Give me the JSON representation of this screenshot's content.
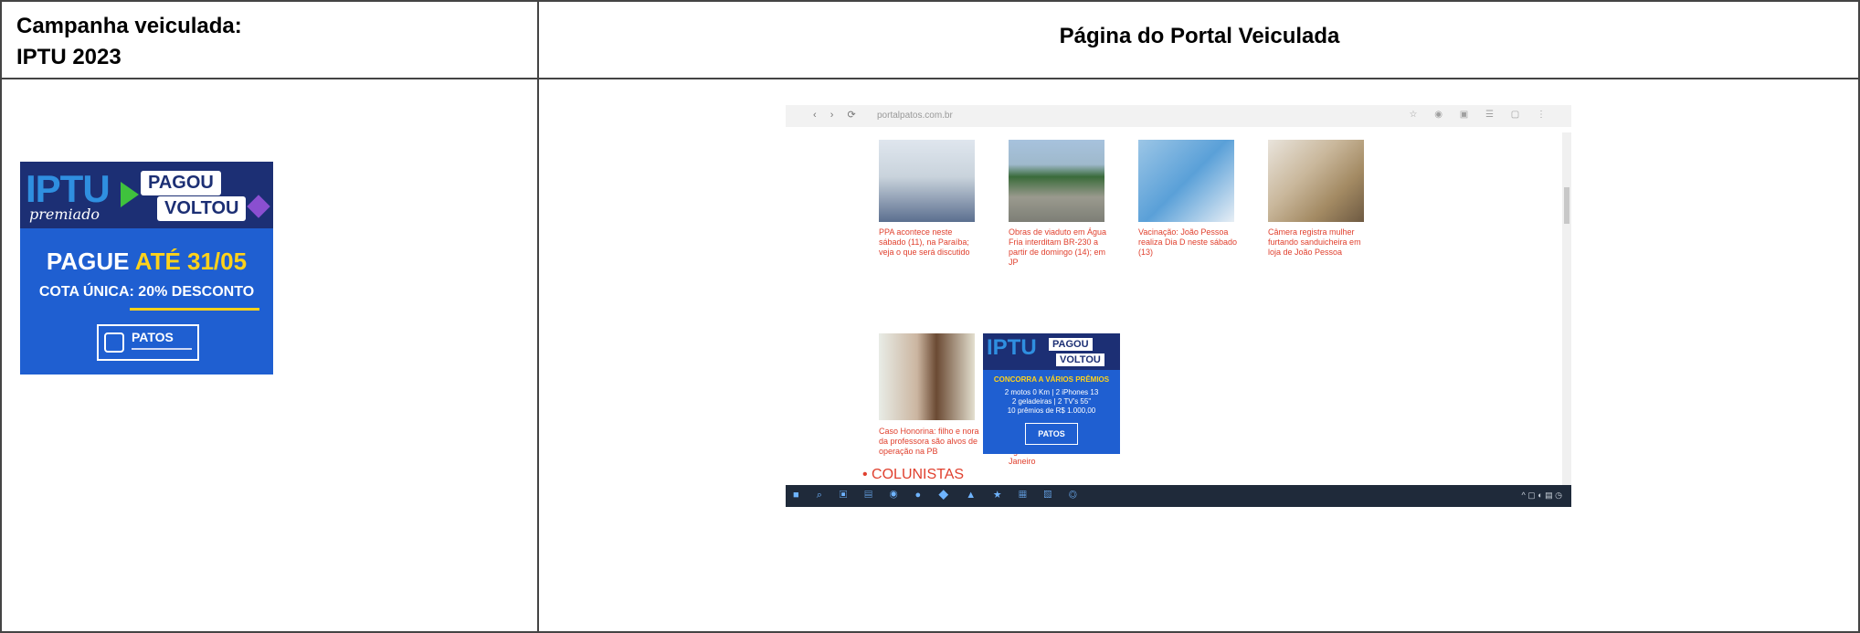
{
  "table": {
    "left_header_line1": "Campanha veiculada:",
    "left_header_line2": "IPTU 2023",
    "right_header": "Página do Portal Veiculada"
  },
  "banner": {
    "iptu": "IPTU",
    "premiado": "premiado",
    "pagou": "PAGOU",
    "voltou": "VOLTOU",
    "pague": "PAGUE",
    "ate": "ATÉ 31/05",
    "cota": "COTA ÚNICA: 20% DESCONTO",
    "logo": "PATOS",
    "colors": {
      "dark": "#1c2f74",
      "blue": "#1f5fd1",
      "yellow": "#ffd21a",
      "green": "#3fc23d"
    }
  },
  "screenshot": {
    "url": "portalpatos.com.br",
    "captions_row1": [
      "PPA acontece neste sábado (11), na Paraíba; veja o que será discutido",
      "Obras de viaduto em Água Fria interditam BR-230 a partir de domingo (14); em JP",
      "Vacinação: João Pessoa realiza Dia D neste sábado (13)",
      "Câmera registra mulher furtando sanduicheira em loja de João Pessoa"
    ],
    "captions_row2": [
      "Caso Honorina: filho e nora da professora são alvos de operação na PB",
      "Paraibanos são presos suspeitos de explodir agência bancária no Rio de Janeiro"
    ],
    "ad": {
      "iptu": "IPTU",
      "pagou": "PAGOU",
      "voltou": "VOLTOU",
      "concorra": "CONCORRA A VÁRIOS PRÊMIOS",
      "line1": "2 motos 0 Km | 2 iPhones 13",
      "line2": "2 geladeiras | 2 TV's 55\"",
      "line3": "10 prêmios de R$ 1.000,00",
      "logo": "PATOS"
    },
    "colunistas": "• COLUNISTAS"
  }
}
